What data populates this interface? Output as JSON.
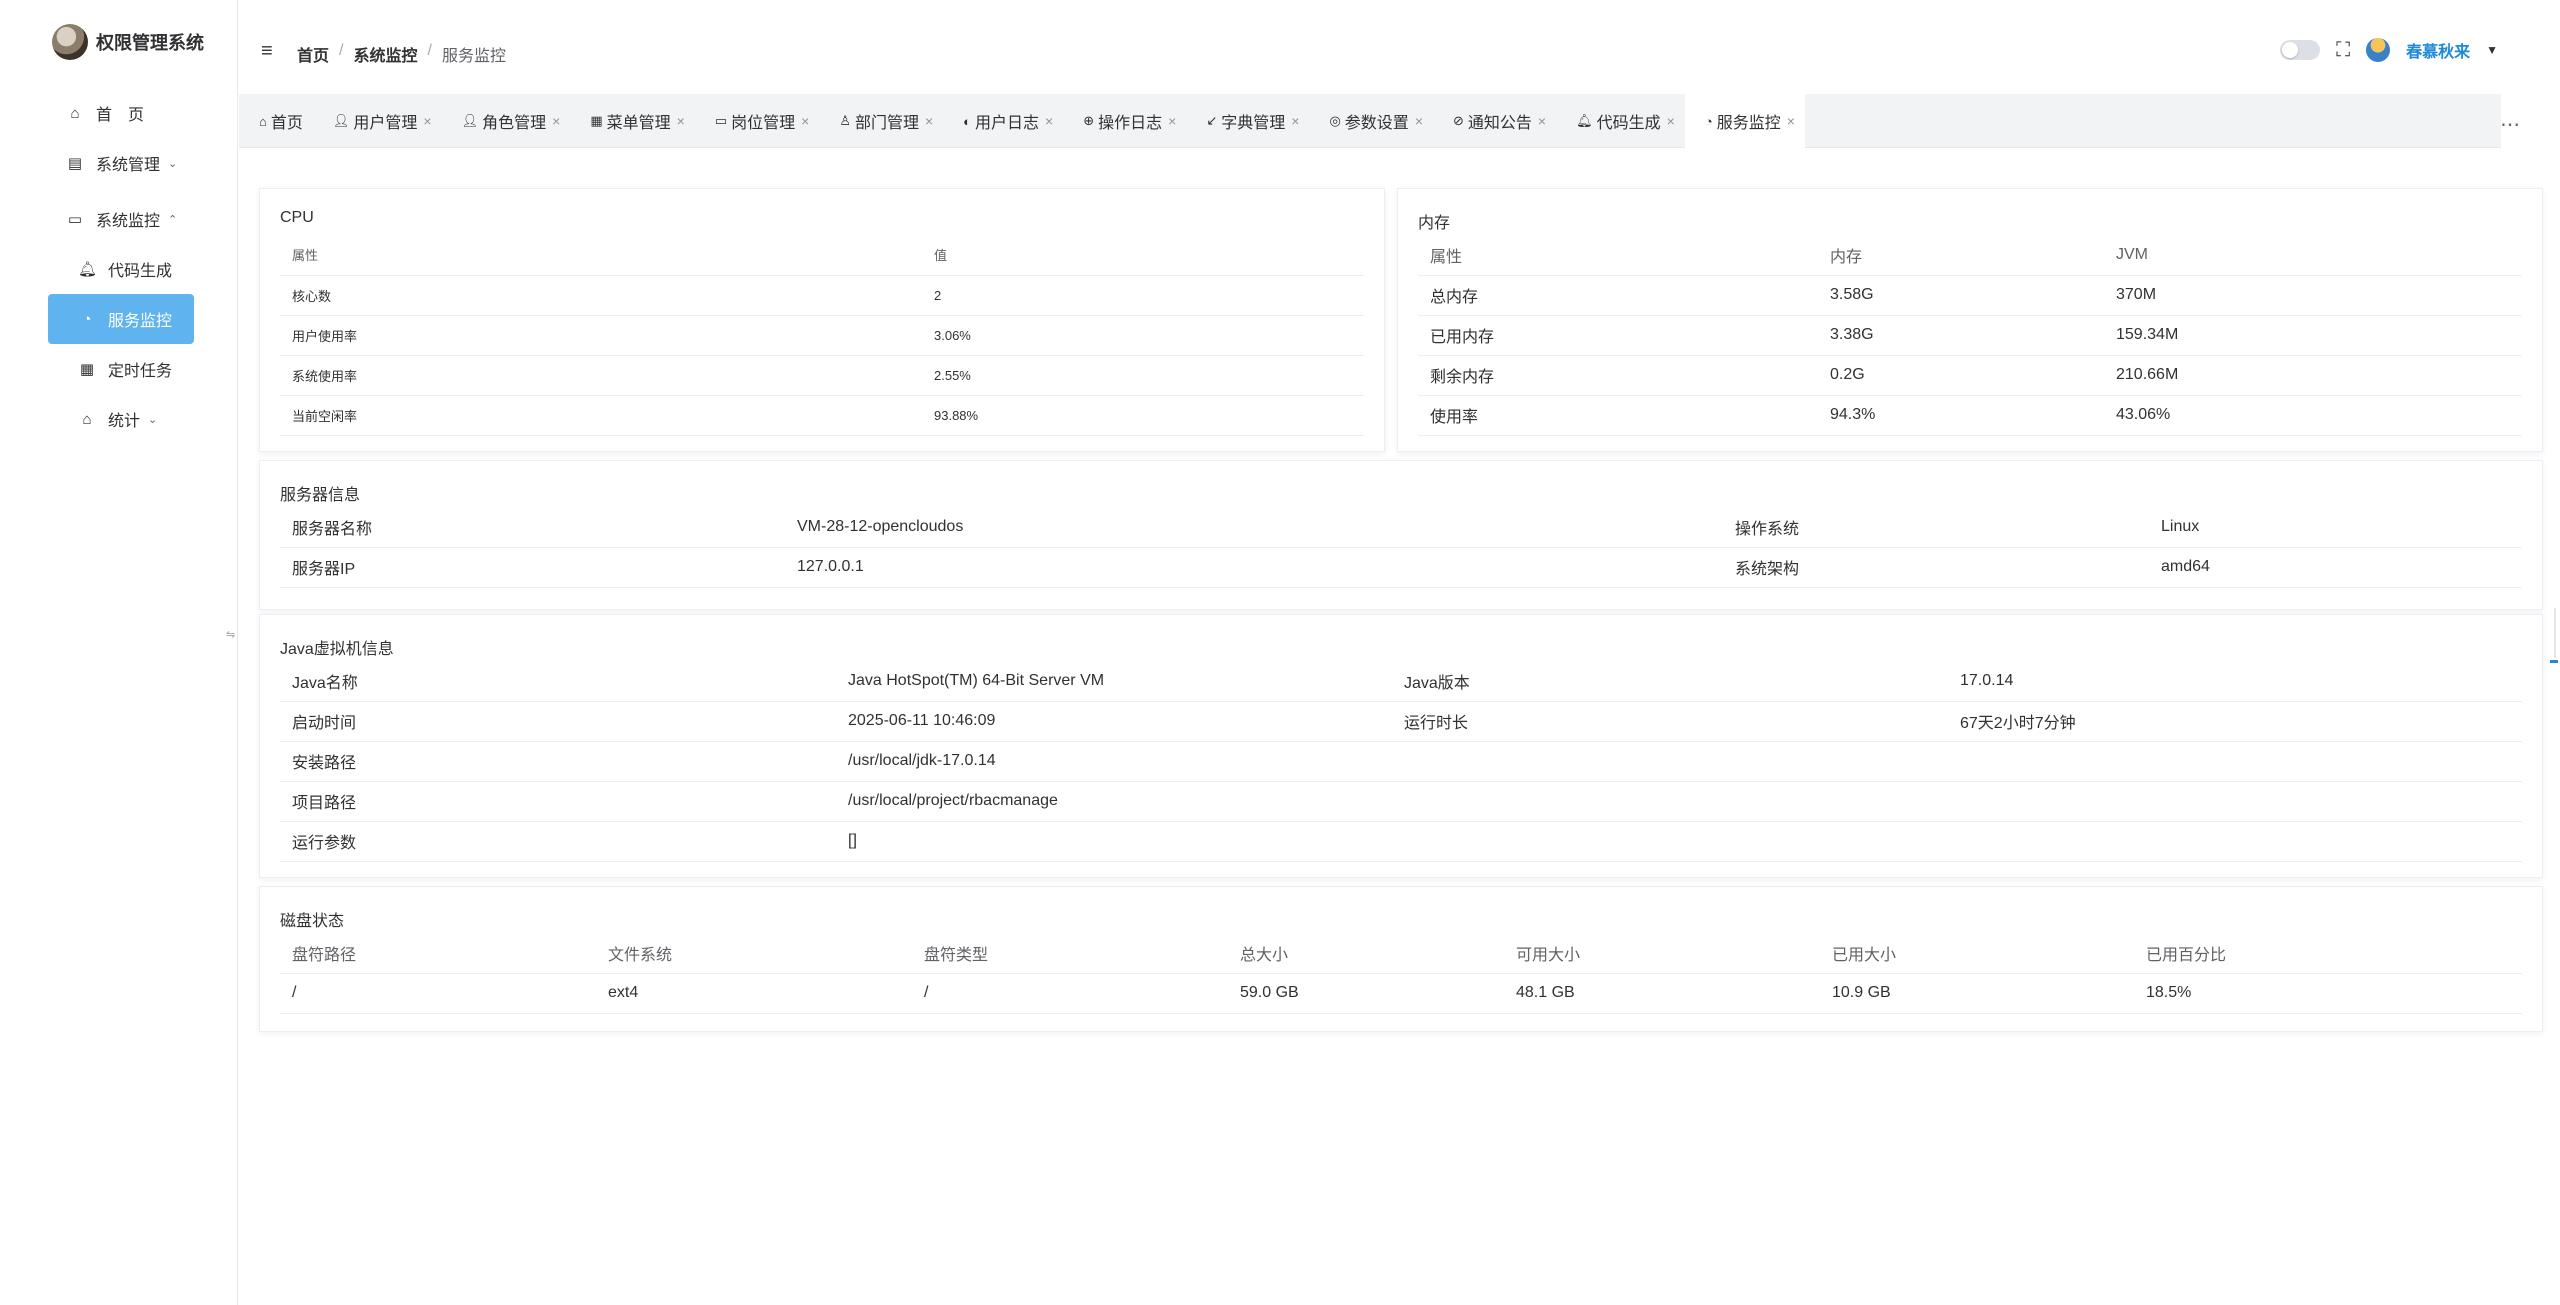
{
  "app": {
    "title": "权限管理系统"
  },
  "sidebar": {
    "items": [
      {
        "label": "首　页",
        "icon": "home-icon"
      },
      {
        "label": "系统管理",
        "icon": "system-icon"
      },
      {
        "label": "系统监控",
        "icon": "monitor-icon"
      },
      {
        "label": "代码生成",
        "icon": "bell-icon"
      },
      {
        "label": "服务监控",
        "icon": "gauge-icon"
      },
      {
        "label": "定时任务",
        "icon": "calendar-icon"
      },
      {
        "label": "统计",
        "icon": "home-icon"
      }
    ]
  },
  "breadcrumb": {
    "home": "首页",
    "mid": "系统监控",
    "last": "服务监控",
    "sep": "/"
  },
  "header": {
    "username": "春慕秋来"
  },
  "tabs": [
    {
      "label": "首页",
      "icon": "home-icon"
    },
    {
      "label": "用户管理",
      "icon": "user-icon"
    },
    {
      "label": "角色管理",
      "icon": "user-icon"
    },
    {
      "label": "菜单管理",
      "icon": "grid-icon"
    },
    {
      "label": "岗位管理",
      "icon": "post-icon"
    },
    {
      "label": "部门管理",
      "icon": "user-icon"
    },
    {
      "label": "用户日志",
      "icon": "log-icon"
    },
    {
      "label": "操作日志",
      "icon": "globe-icon"
    },
    {
      "label": "字典管理",
      "icon": "arrow-icon"
    },
    {
      "label": "参数设置",
      "icon": "chrome-icon"
    },
    {
      "label": "通知公告",
      "icon": "check-icon"
    },
    {
      "label": "代码生成",
      "icon": "bell-icon"
    },
    {
      "label": "服务监控",
      "icon": "gauge-icon"
    }
  ],
  "cpu": {
    "title": "CPU",
    "headers": [
      "属性",
      "值"
    ],
    "rows": [
      [
        "核心数",
        "2"
      ],
      [
        "用户使用率",
        "3.06%"
      ],
      [
        "系统使用率",
        "2.55%"
      ],
      [
        "当前空闲率",
        "93.88%"
      ]
    ]
  },
  "memory": {
    "title": "内存",
    "headers": [
      "属性",
      "内存",
      "JVM"
    ],
    "rows": [
      [
        "总内存",
        "3.58G",
        "370M"
      ],
      [
        "已用内存",
        "3.38G",
        "159.34M"
      ],
      [
        "剩余内存",
        "0.2G",
        "210.66M"
      ],
      [
        "使用率",
        "94.3%",
        "43.06%"
      ]
    ]
  },
  "server": {
    "title": "服务器信息",
    "rows": [
      [
        "服务器名称",
        "VM-28-12-opencloudos",
        "操作系统",
        "Linux"
      ],
      [
        "服务器IP",
        "127.0.0.1",
        "系统架构",
        "amd64"
      ]
    ]
  },
  "jvm": {
    "title": "Java虚拟机信息",
    "rows": [
      [
        "Java名称",
        "Java HotSpot(TM) 64-Bit Server VM",
        "Java版本",
        "17.0.14"
      ],
      [
        "启动时间",
        "2025-06-11 10:46:09",
        "运行时长",
        "67天2小时7分钟"
      ],
      [
        "安装路径",
        "/usr/local/jdk-17.0.14",
        "",
        ""
      ],
      [
        "项目路径",
        "/usr/local/project/rbacmanage",
        "",
        ""
      ],
      [
        "运行参数",
        "[]",
        "",
        ""
      ]
    ]
  },
  "disk": {
    "title": "磁盘状态",
    "headers": [
      "盘符路径",
      "文件系统",
      "盘符类型",
      "总大小",
      "可用大小",
      "已用大小",
      "已用百分比"
    ],
    "rows": [
      [
        "/",
        "ext4",
        "/",
        "59.0 GB",
        "48.1 GB",
        "10.9 GB",
        "18.5%"
      ]
    ]
  }
}
